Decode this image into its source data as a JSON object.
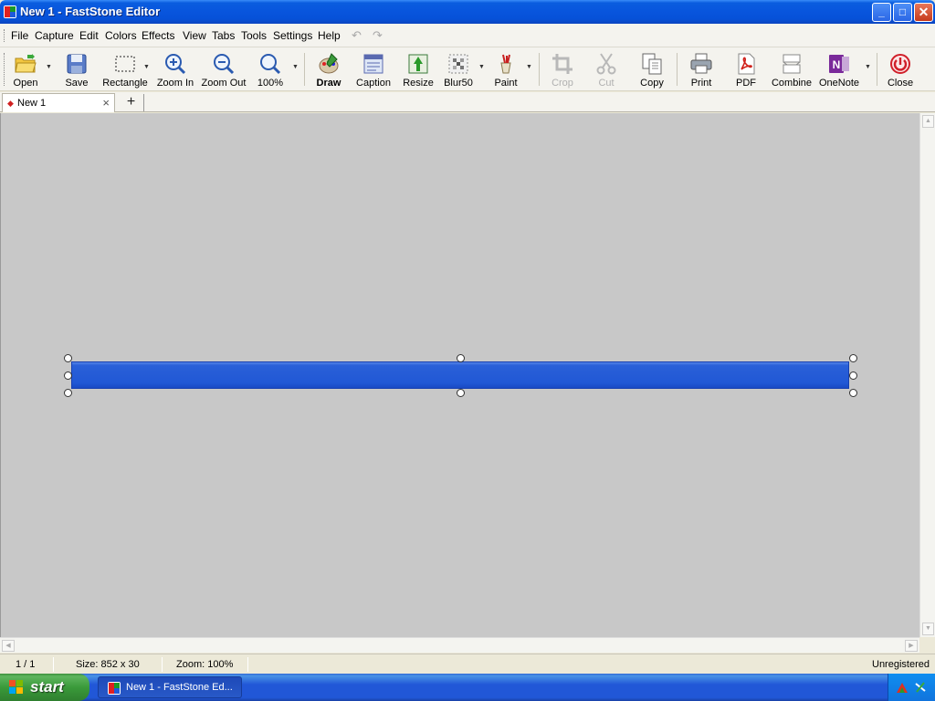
{
  "window": {
    "title": "New 1 - FastStone Editor",
    "buttons": {
      "minimize": "_",
      "maximize": "□",
      "close": "✕"
    }
  },
  "menu": [
    "File",
    "Capture",
    "Edit",
    "Colors",
    "Effects",
    "View",
    "Tabs",
    "Tools",
    "Settings",
    "Help"
  ],
  "toolbar": {
    "open": "Open",
    "save": "Save",
    "rectangle": "Rectangle",
    "zoom_in": "Zoom In",
    "zoom_out": "Zoom Out",
    "zoom_100": "100%",
    "draw": "Draw",
    "caption": "Caption",
    "resize": "Resize",
    "blur": "Blur50",
    "paint": "Paint",
    "crop": "Crop",
    "cut": "Cut",
    "copy": "Copy",
    "print": "Print",
    "pdf": "PDF",
    "combine": "Combine",
    "onenote": "OneNote",
    "close": "Close"
  },
  "tabs": {
    "active": "New 1",
    "close_glyph": "×",
    "add_glyph": "+"
  },
  "canvas": {
    "image_color": "#2158d5",
    "background_color": "#c8c8c8"
  },
  "status": {
    "page": "1 / 1",
    "size": "Size: 852 x 30",
    "zoom": "Zoom: 100%",
    "registration": "Unregistered"
  },
  "taskbar": {
    "start": "start",
    "task_item": "New 1 - FastStone Ed..."
  }
}
